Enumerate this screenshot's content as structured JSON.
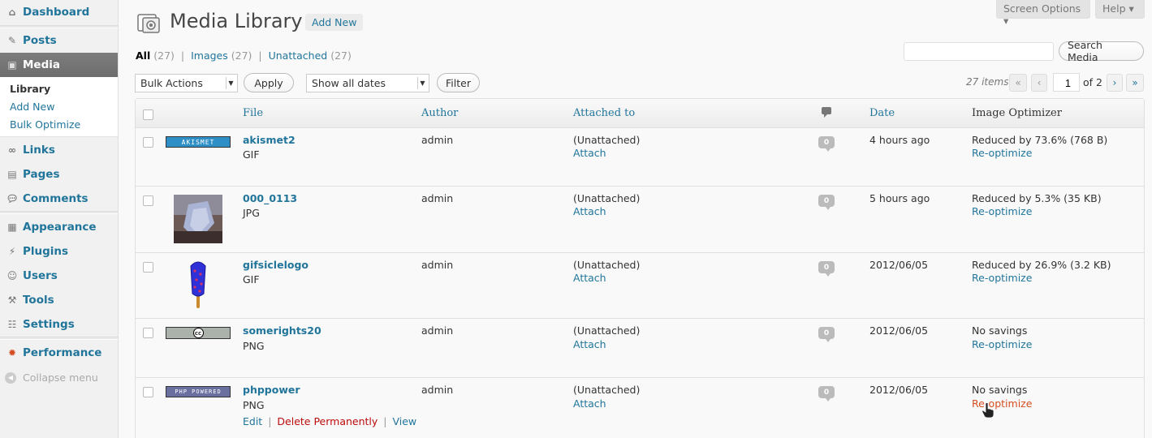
{
  "sidebar": {
    "items": [
      {
        "label": "Dashboard",
        "icon": "dashboard-icon"
      },
      {
        "label": "Posts",
        "icon": "pin-icon"
      },
      {
        "label": "Media",
        "icon": "media-icon"
      },
      {
        "label": "Links",
        "icon": "link-icon"
      },
      {
        "label": "Pages",
        "icon": "pages-icon"
      },
      {
        "label": "Comments",
        "icon": "comment-icon"
      },
      {
        "label": "Appearance",
        "icon": "appearance-icon"
      },
      {
        "label": "Plugins",
        "icon": "plugin-icon"
      },
      {
        "label": "Users",
        "icon": "users-icon"
      },
      {
        "label": "Tools",
        "icon": "tools-icon"
      },
      {
        "label": "Settings",
        "icon": "settings-icon"
      },
      {
        "label": "Performance",
        "icon": "performance-icon"
      }
    ],
    "submenu": [
      "Library",
      "Add New",
      "Bulk Optimize"
    ],
    "collapse": "Collapse menu"
  },
  "screen_options": "Screen Options ▾",
  "help": "Help ▾",
  "header": {
    "title": "Media Library",
    "add_new": "Add New"
  },
  "filters": {
    "all": "All",
    "all_count": "(27)",
    "images": "Images",
    "images_count": "(27)",
    "unattached": "Unattached",
    "unattached_count": "(27)",
    "sep": "|"
  },
  "search": {
    "placeholder": "",
    "button": "Search Media"
  },
  "bulk": {
    "selected": "Bulk Actions",
    "apply": "Apply"
  },
  "dates": {
    "selected": "Show all dates",
    "filter": "Filter"
  },
  "pagination": {
    "count": "27 items",
    "first": "«",
    "prev": "‹",
    "current": "1",
    "of": "of 2",
    "next": "›",
    "last": "»"
  },
  "columns": {
    "file": "File",
    "author": "Author",
    "attached": "Attached to",
    "date": "Date",
    "optimizer": "Image Optimizer"
  },
  "rows": [
    {
      "name": "akismet2",
      "type": "GIF",
      "author": "admin",
      "attached": "(Unattached)",
      "attach": "Attach",
      "comments": "0",
      "date": "4 hours ago",
      "optimizer": "Reduced by 73.6% (768 B)",
      "reoptimize": "Re-optimize",
      "thumb_text": "AKISMET"
    },
    {
      "name": "000_0113",
      "type": "JPG",
      "author": "admin",
      "attached": "(Unattached)",
      "attach": "Attach",
      "comments": "0",
      "date": "5 hours ago",
      "optimizer": "Reduced by 5.3% (35 KB)",
      "reoptimize": "Re-optimize",
      "thumb_text": ""
    },
    {
      "name": "gifsiclelogo",
      "type": "GIF",
      "author": "admin",
      "attached": "(Unattached)",
      "attach": "Attach",
      "comments": "0",
      "date": "2012/06/05",
      "optimizer": "Reduced by 26.9% (3.2 KB)",
      "reoptimize": "Re-optimize",
      "thumb_text": ""
    },
    {
      "name": "somerights20",
      "type": "PNG",
      "author": "admin",
      "attached": "(Unattached)",
      "attach": "Attach",
      "comments": "0",
      "date": "2012/06/05",
      "optimizer": "No savings",
      "reoptimize": "Re-optimize",
      "thumb_text": "cc"
    },
    {
      "name": "phppower",
      "type": "PNG",
      "author": "admin",
      "attached": "(Unattached)",
      "attach": "Attach",
      "comments": "0",
      "date": "2012/06/05",
      "optimizer": "No savings",
      "reoptimize": "Re-optimize",
      "thumb_text": "PHP POWERED"
    }
  ],
  "row_actions": {
    "edit": "Edit",
    "delete": "Delete Permanently",
    "view": "View",
    "sep": "|"
  },
  "colors": {
    "link": "#21759b",
    "hover_link": "#d54e21",
    "delete": "#bc0b0b",
    "active_menu": "#6d6d6d"
  }
}
